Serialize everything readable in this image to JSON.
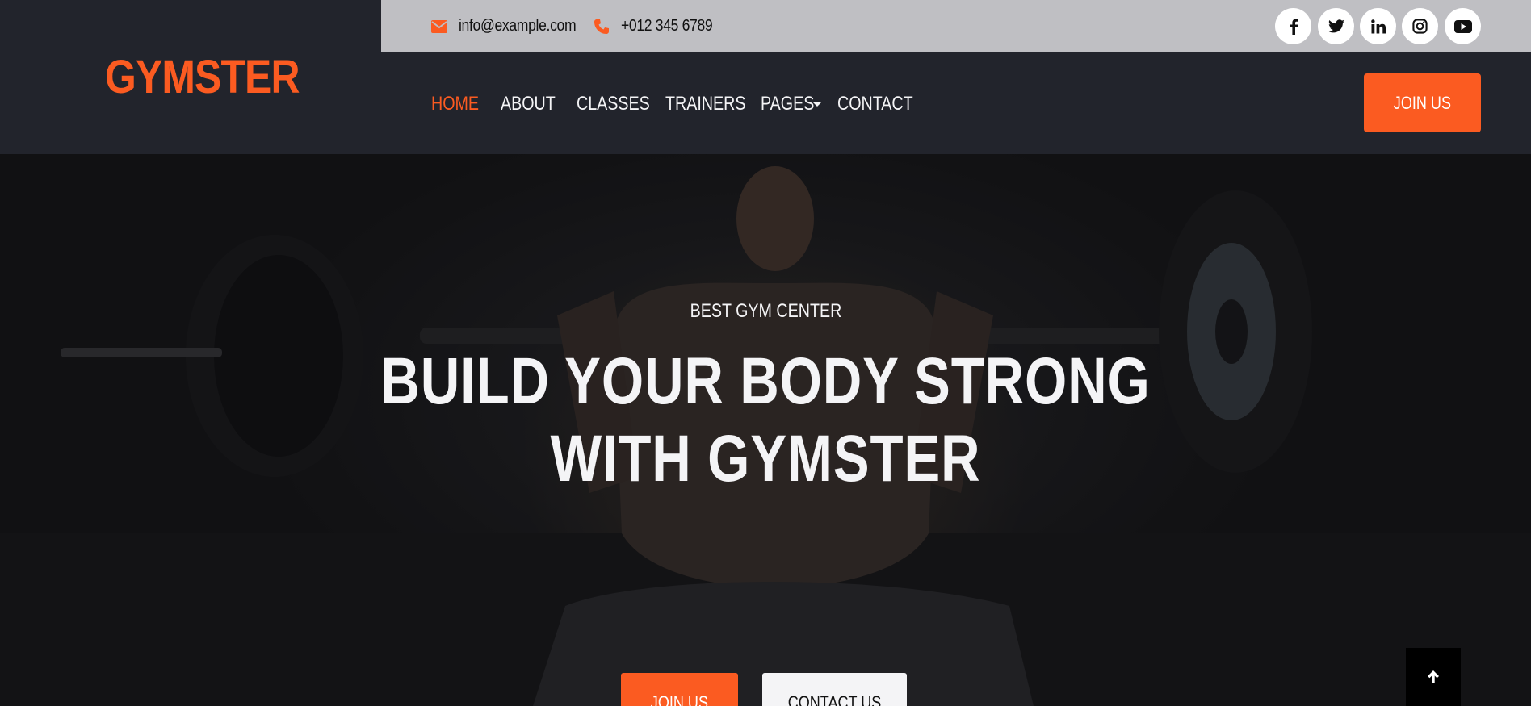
{
  "brand": {
    "logo_text": "GYMSTER",
    "accent": "#fb5b21"
  },
  "topbar": {
    "email_icon": "envelope-icon",
    "email": "info@example.com",
    "phone_icon": "phone-icon",
    "phone": "+012 345 6789",
    "social": [
      "facebook-icon",
      "twitter-icon",
      "linkedin-icon",
      "instagram-icon",
      "youtube-icon"
    ]
  },
  "nav": {
    "items": [
      {
        "label": "HOME",
        "active": true
      },
      {
        "label": "ABOUT"
      },
      {
        "label": "CLASSES"
      },
      {
        "label": "TRAINERS"
      },
      {
        "label": "PAGES",
        "dropdown": true
      },
      {
        "label": "CONTACT"
      }
    ],
    "cta": "JOIN US"
  },
  "hero": {
    "eyebrow": "BEST GYM CENTER",
    "headline_line1": "BUILD YOUR BODY STRONG",
    "headline_line2": "WITH GYMSTER",
    "primary_button": "JOIN US",
    "secondary_button": "CONTACT US"
  },
  "back_to_top_icon": "arrow-up-icon"
}
